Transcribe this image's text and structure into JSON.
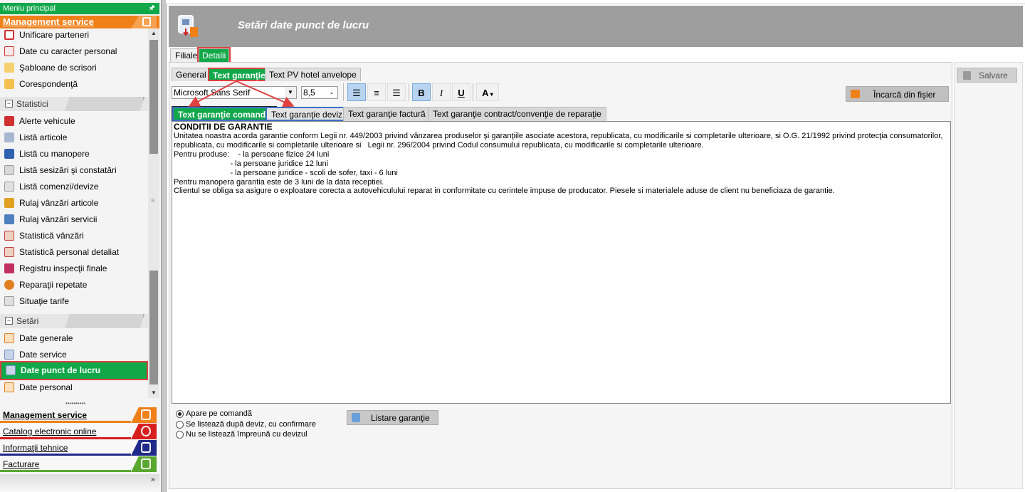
{
  "sidebar": {
    "title": "Meniu principal",
    "pin": "🖈",
    "section_head": "Management service",
    "items": [
      {
        "label": "Unificare parteneri",
        "icon": "merge-partners-icon",
        "color": "#d03030"
      },
      {
        "label": "Date cu caracter personal",
        "icon": "personal-data-icon",
        "color": "#d03030"
      },
      {
        "label": "Şabloane de scrisori",
        "icon": "letter-template-icon",
        "color": "#e8b030"
      },
      {
        "label": "Corespondenţă",
        "icon": "envelope-icon",
        "color": "#e8b030"
      }
    ],
    "section_statistici": "Statistici",
    "statistici": [
      {
        "label": "Alerte vehicule",
        "icon": "alert-vehicle-icon",
        "color": "#d03030"
      },
      {
        "label": "Listă articole",
        "icon": "article-list-icon",
        "color": "#6080b0"
      },
      {
        "label": "Listă cu manopere",
        "icon": "wrench-icon",
        "color": "#3060b0"
      },
      {
        "label": "Listă sesizări şi constatări",
        "icon": "checklist-icon",
        "color": "#909090"
      },
      {
        "label": "Listă comenzi/devize",
        "icon": "order-list-icon",
        "color": "#909090"
      },
      {
        "label": "Rulaj vânzări articole",
        "icon": "sales-articles-icon",
        "color": "#e0a020"
      },
      {
        "label": "Rulaj vânzări servicii",
        "icon": "sales-services-icon",
        "color": "#3060b0"
      },
      {
        "label": "Statistică vânzări",
        "icon": "sales-stats-icon",
        "color": "#c04040"
      },
      {
        "label": "Statistică personal detaliat",
        "icon": "staff-stats-icon",
        "color": "#c04040"
      },
      {
        "label": "Registru inspecţii finale",
        "icon": "inspection-register-icon",
        "color": "#c03060"
      },
      {
        "label": "Reparaţii repetate",
        "icon": "repeat-repair-icon",
        "color": "#e08020"
      },
      {
        "label": "Situaţie tarife",
        "icon": "tariff-icon",
        "color": "#909090"
      }
    ],
    "section_setari": "Setări",
    "setari": [
      {
        "label": "Date generale",
        "icon": "general-data-icon",
        "color": "#e08020"
      },
      {
        "label": "Date service",
        "icon": "service-data-icon",
        "color": "#7090c0"
      },
      {
        "label": "Date punct de lucru",
        "icon": "workpoint-icon",
        "color": "#7090c0"
      },
      {
        "label": "Date personal",
        "icon": "personnel-icon",
        "color": "#e08020"
      }
    ],
    "nav": [
      {
        "label": "Management service",
        "color": "#f08018"
      },
      {
        "label": "Catalog electronic online",
        "color": "#d82020"
      },
      {
        "label": "Informaţii tehnice",
        "color": "#202a8a"
      },
      {
        "label": "Facturare",
        "color": "#5aa830"
      }
    ],
    "more": "»"
  },
  "header": {
    "title": "Setări date punct de lucru"
  },
  "tabs_level1": [
    "Filiale",
    "Detalii"
  ],
  "tabs_level2": [
    "General",
    "Text garanţie",
    "Text PV hotel anvelope"
  ],
  "toolbar": {
    "font": "Microsoft Sans Serif",
    "size": "8,5",
    "align_left": "≡",
    "bold": "B",
    "italic": "I",
    "underline": "U",
    "font_color": "A"
  },
  "buttons": {
    "incarca": "Încarcă din fişier",
    "salvare": "Salvare",
    "listare": "Listare garanţie"
  },
  "tabs_level3": [
    "Text garanţie comandă",
    "Text garanţie deviz",
    "Text garanţie factură",
    "Text garanţie contract/convenţie de reparaţie"
  ],
  "editor": {
    "heading": "CONDITII DE GARANTIE",
    "lines": [
      "Unitatea noastra acorda garantie conform Legii nr. 449/2003 privind vânzarea produselor şi garanţiile asociate acestora, republicata, cu modificarile si completarile ulterioare, si O.G. 21/1992 privind protecţia consumatorilor,",
      "republicata, cu modificarile si completarile ulterioare si   Legii nr. 296/2004 privind Codul consumului republicata, cu modificarile si completarile ulterioare.",
      "Pentru produse:    - la persoane fizice 24 luni",
      "                          - la persoane juridice 12 luni",
      "                          - la persoane juridice - scoli de sofer, taxi - 6 luni",
      "Pentru manopera garantia este de 3 luni de la data receptiei.",
      "Clientul se obliga sa asigure o exploatare corecta a autovehiculului reparat in conformitate cu cerintele impuse de producator. Piesele si materialele aduse de client nu beneficiaza de garantie."
    ]
  },
  "radios": [
    {
      "label": "Apare pe comandă",
      "checked": true
    },
    {
      "label": "Se listează după deviz, cu confirmare",
      "checked": false
    },
    {
      "label": "Nu se listează împreună cu devizul",
      "checked": false
    }
  ],
  "colors": {
    "green": "#11a84a",
    "orange": "#f08018",
    "highlight_red": "#e04040",
    "highlight_blue": "#3b6fc8"
  }
}
